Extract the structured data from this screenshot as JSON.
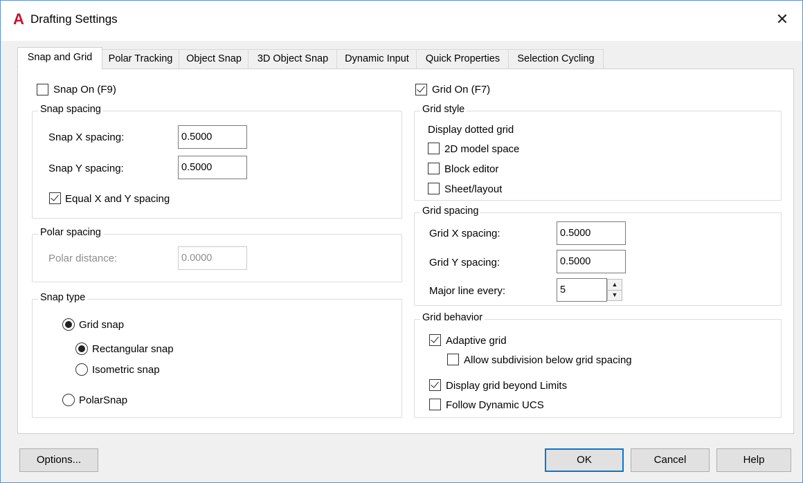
{
  "window": {
    "title": "Drafting Settings",
    "app_icon": "A",
    "close_glyph": "✕"
  },
  "tabs": [
    {
      "label": "Snap and Grid",
      "active": true
    },
    {
      "label": "Polar Tracking"
    },
    {
      "label": "Object Snap"
    },
    {
      "label": "3D Object Snap"
    },
    {
      "label": "Dynamic Input"
    },
    {
      "label": "Quick Properties"
    },
    {
      "label": "Selection Cycling"
    }
  ],
  "snap": {
    "snap_on_label": "Snap On (F9)",
    "snap_on_checked": false,
    "spacing_group": "Snap spacing",
    "x_label": "Snap X spacing:",
    "x_value": "0.5000",
    "y_label": "Snap Y spacing:",
    "y_value": "0.5000",
    "equal_label": "Equal X and Y spacing",
    "equal_checked": true,
    "polar_group": "Polar spacing",
    "polar_label": "Polar distance:",
    "polar_value": "0.0000",
    "type_group": "Snap type",
    "grid_snap_label": "Grid snap",
    "rect_label": "Rectangular snap",
    "iso_label": "Isometric snap",
    "polarsnap_label": "PolarSnap"
  },
  "grid": {
    "grid_on_label": "Grid On (F7)",
    "grid_on_checked": true,
    "style_group": "Grid style",
    "dotted_label": "Display dotted grid",
    "model_label": "2D model space",
    "block_label": "Block editor",
    "sheet_label": "Sheet/layout",
    "spacing_group": "Grid spacing",
    "x_label": "Grid X spacing:",
    "x_value": "0.5000",
    "y_label": "Grid Y spacing:",
    "y_value": "0.5000",
    "major_label": "Major line every:",
    "major_value": "5",
    "behavior_group": "Grid behavior",
    "adaptive_label": "Adaptive grid",
    "subdiv_label": "Allow subdivision below grid spacing",
    "beyond_label": "Display grid beyond Limits",
    "follow_label": "Follow Dynamic UCS"
  },
  "buttons": {
    "options": "Options...",
    "ok": "OK",
    "cancel": "Cancel",
    "help": "Help"
  },
  "colors": {
    "accent": "#0078d7",
    "app_icon": "#c8102e",
    "window_border": "#5b8fd0"
  }
}
